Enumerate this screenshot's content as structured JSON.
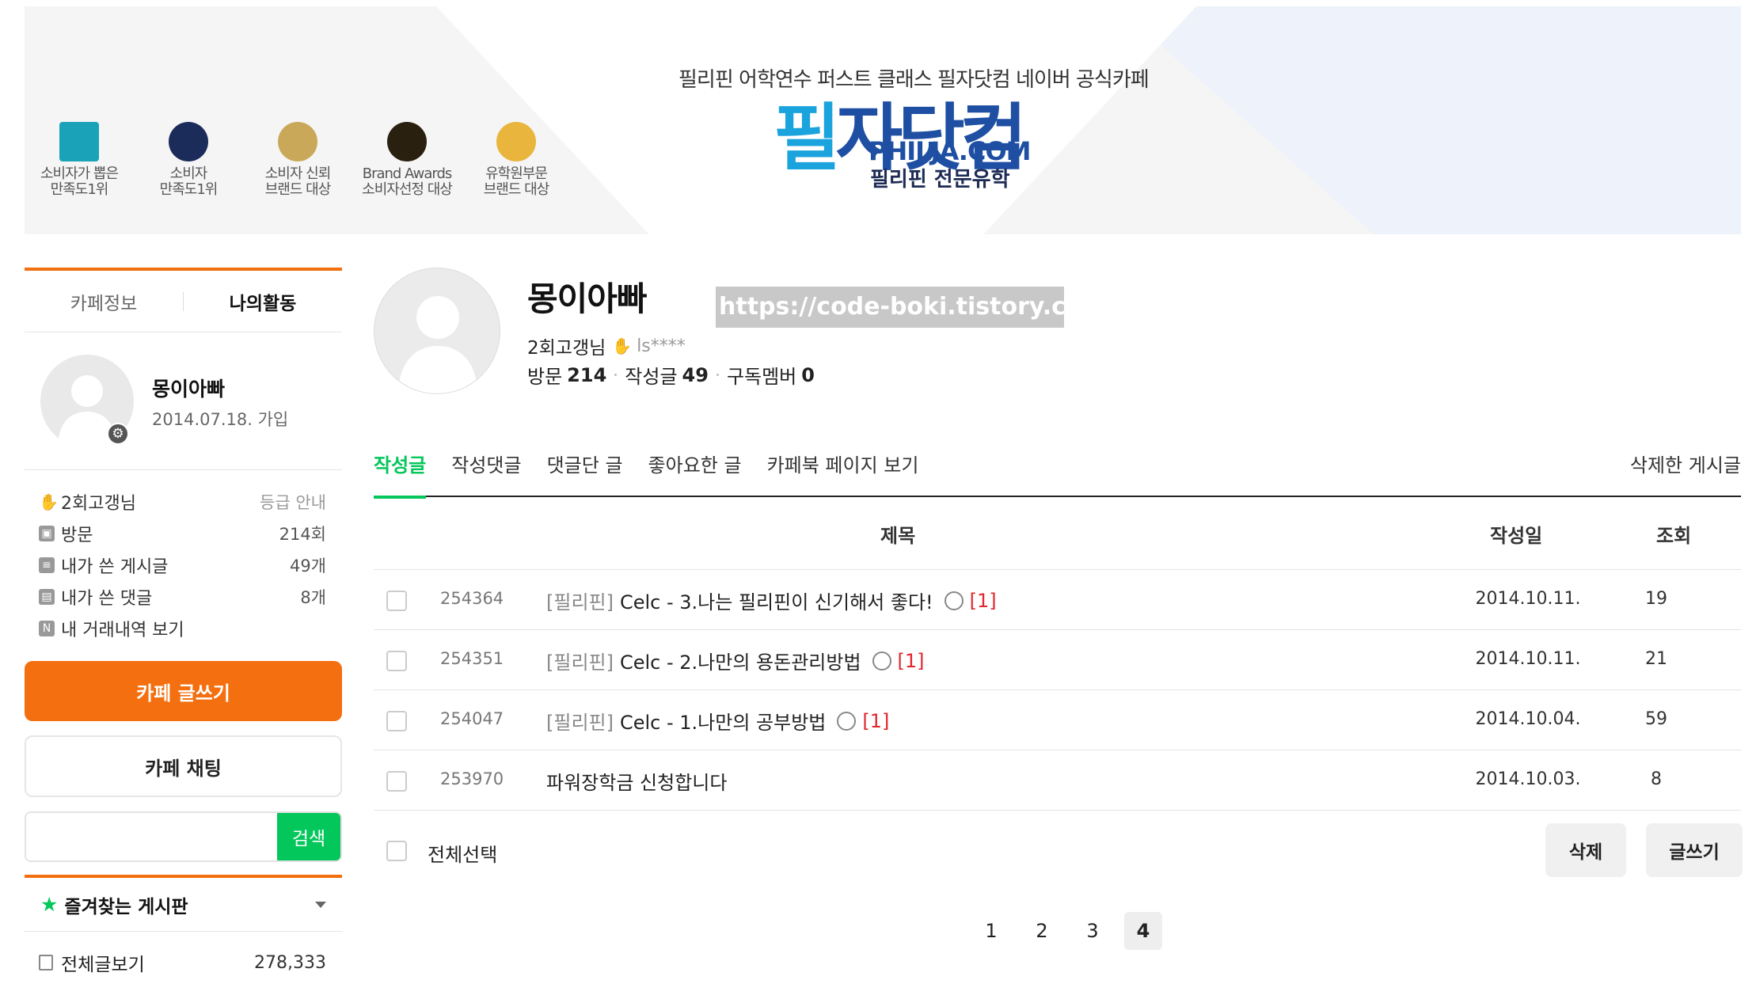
{
  "banner": {
    "tagline": "필리핀 어학연수 퍼스트 클래스  필자닷컴 네이버 공식카페",
    "logo_main_a": "필",
    "logo_main_b": "자닷컴",
    "logo_en": "PHILJA.COM",
    "logo_ko": "필리핀 전문유학",
    "awards": [
      {
        "label": "소비자가 뽑은\n만족도1위",
        "icon": "ksci-badge-icon",
        "color": "#1aa3b8"
      },
      {
        "label": "소비자\n만족도1위",
        "icon": "kcsa-badge-icon",
        "color": "#1c2c5a"
      },
      {
        "label": "소비자 신뢰\n브랜드 대상",
        "icon": "crown-badge-icon",
        "color": "#c9a85a"
      },
      {
        "label": "Brand Awards\n소비자선정 대상",
        "icon": "brand-awards-badge-icon",
        "color": "#2a2010"
      },
      {
        "label": "유학원부문\n브랜드 대상",
        "icon": "gold-medal-badge-icon",
        "color": "#e9b53c"
      }
    ]
  },
  "sidebar": {
    "tabs": [
      "카페정보",
      "나의활동"
    ],
    "profile": {
      "name": "몽이아빠",
      "joined": "2014.07.18. 가입"
    },
    "stats": [
      {
        "icon": "hand-icon",
        "label": "2회고갱님",
        "value": "등급 안내"
      },
      {
        "icon": "visit-icon",
        "label": "방문",
        "value": "214회"
      },
      {
        "icon": "post-icon",
        "label": "내가 쓴 게시글",
        "value": "49개"
      },
      {
        "icon": "comment-icon",
        "label": "내가 쓴 댓글",
        "value": "8개"
      },
      {
        "icon": "n-pay-icon",
        "label": "내 거래내역 보기",
        "value": ""
      }
    ],
    "write_button": "카페 글쓰기",
    "chat_button": "카페 채팅",
    "search_placeholder": "",
    "search_button": "검색",
    "favorites_label": "즐겨찾는 게시판",
    "all_posts_label": "전체글보기",
    "all_posts_count": "278,333"
  },
  "main": {
    "name": "몽이아빠",
    "watermark": "https://code-boki.tistory.com",
    "grade": "2회고갱님",
    "user_id": "ls****",
    "visit_label": "방문",
    "visit_value": "214",
    "posts_label": "작성글",
    "posts_value": "49",
    "subs_label": "구독멤버",
    "subs_value": "0",
    "tabs": [
      "작성글",
      "작성댓글",
      "댓글단 글",
      "좋아요한 글",
      "카페북 페이지 보기"
    ],
    "deleted_tab": "삭제한 게시글",
    "columns": {
      "title": "제목",
      "date": "작성일",
      "views": "조회"
    },
    "posts": [
      {
        "no": "254364",
        "head": "[필리핀]",
        "title": "Celc - 3.나는 필리핀이 신기해서 좋다!",
        "has_image": true,
        "comments": "[1]",
        "date": "2014.10.11.",
        "views": "19"
      },
      {
        "no": "254351",
        "head": "[필리핀]",
        "title": "Celc - 2.나만의 용돈관리방법",
        "has_image": true,
        "comments": "[1]",
        "date": "2014.10.11.",
        "views": "21"
      },
      {
        "no": "254047",
        "head": "[필리핀]",
        "title": "Celc - 1.나만의 공부방법",
        "has_image": true,
        "comments": "[1]",
        "date": "2014.10.04.",
        "views": "59"
      },
      {
        "no": "253970",
        "head": "",
        "title": "파워장학금 신청합니다",
        "has_image": false,
        "comments": "",
        "date": "2014.10.03.",
        "views": "8"
      }
    ],
    "select_all": "전체선택",
    "delete_button": "삭제",
    "write_button": "글쓰기",
    "pages": [
      "1",
      "2",
      "3",
      "4"
    ],
    "current_page": "4"
  },
  "colors": {
    "accent": "#f36f0f",
    "green": "#03c75a",
    "logo_blue": "#1aa3dc",
    "logo_navy": "#1e4fa3"
  }
}
